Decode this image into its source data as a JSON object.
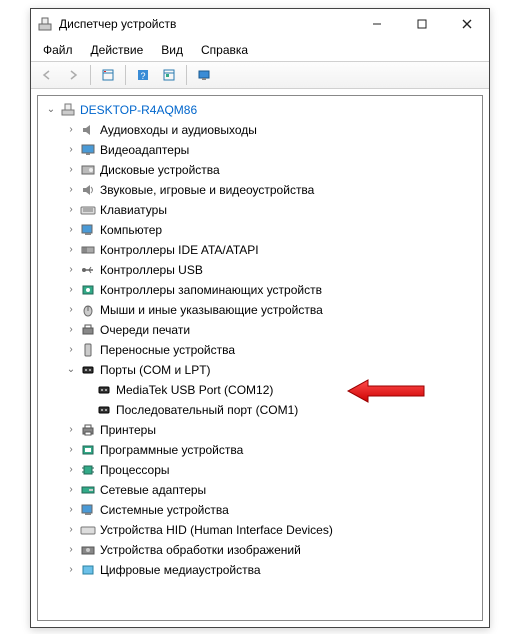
{
  "window": {
    "title": "Диспетчер устройств"
  },
  "menu": {
    "file": "Файл",
    "action": "Действие",
    "view": "Вид",
    "help": "Справка"
  },
  "tree": {
    "root": "DESKTOP-R4AQM86",
    "audio": "Аудиовходы и аудиовыходы",
    "video": "Видеоадаптеры",
    "disk": "Дисковые устройства",
    "sound": "Звуковые, игровые и видеоустройства",
    "keyboard": "Клавиатуры",
    "computer": "Компьютер",
    "ide": "Контроллеры IDE ATA/ATAPI",
    "usb": "Контроллеры USB",
    "storage": "Контроллеры запоминающих устройств",
    "mouse": "Мыши и иные указывающие устройства",
    "printq": "Очереди печати",
    "portable": "Переносные устройства",
    "ports": "Порты (COM и LPT)",
    "mtk": "MediaTek USB Port (COM12)",
    "com1": "Последовательный порт (COM1)",
    "printers": "Принтеры",
    "software": "Программные устройства",
    "cpu": "Процессоры",
    "net": "Сетевые адаптеры",
    "system": "Системные устройства",
    "hid": "Устройства HID (Human Interface Devices)",
    "imaging": "Устройства обработки изображений",
    "media": "Цифровые медиаустройства"
  }
}
